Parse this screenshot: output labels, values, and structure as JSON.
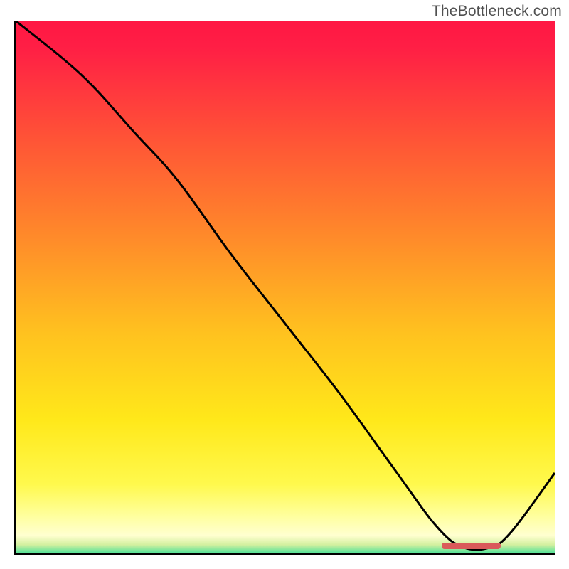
{
  "attribution": "TheBottleneck.com",
  "colors": {
    "gradient_stops": [
      {
        "offset": 0.0,
        "color": "#ff1744"
      },
      {
        "offset": 0.05,
        "color": "#ff1f45"
      },
      {
        "offset": 0.22,
        "color": "#ff5436"
      },
      {
        "offset": 0.4,
        "color": "#ff8a2a"
      },
      {
        "offset": 0.58,
        "color": "#ffc21f"
      },
      {
        "offset": 0.74,
        "color": "#ffe81a"
      },
      {
        "offset": 0.86,
        "color": "#fff94d"
      },
      {
        "offset": 0.92,
        "color": "#ffffa0"
      },
      {
        "offset": 0.955,
        "color": "#ffffd0"
      },
      {
        "offset": 0.972,
        "color": "#d4f0a0"
      },
      {
        "offset": 0.985,
        "color": "#68e49a"
      },
      {
        "offset": 1.0,
        "color": "#00d88a"
      }
    ],
    "curve_stroke": "#000000",
    "axis": "#000000",
    "marker": "#da5a5a"
  },
  "chart_data": {
    "type": "line",
    "title": "",
    "xlabel": "",
    "ylabel": "",
    "x_range": [
      0,
      100
    ],
    "y_range": [
      0,
      100
    ],
    "series": [
      {
        "name": "bottleneck-curve",
        "x": [
          0,
          12,
          22,
          30,
          40,
          50,
          60,
          70,
          78,
          83,
          88,
          92,
          100
        ],
        "y": [
          100,
          90,
          79,
          70,
          56,
          43,
          30,
          16,
          5,
          1,
          1,
          4,
          15
        ]
      }
    ],
    "marker": {
      "name": "optimal-range",
      "x_start": 79,
      "x_end": 90,
      "y": 0.7
    }
  }
}
